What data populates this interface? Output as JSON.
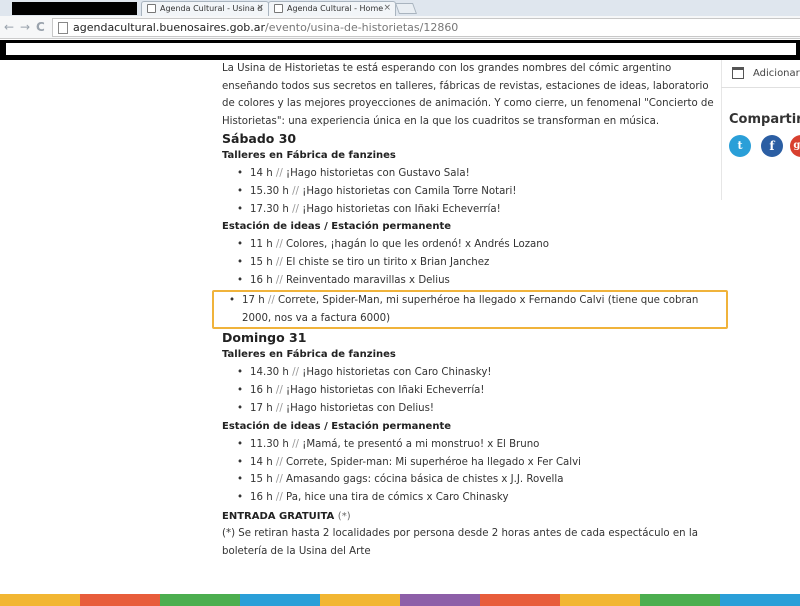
{
  "browser": {
    "tabs": [
      {
        "title": "Agenda Cultural - Usina d",
        "close": "×"
      },
      {
        "title": "Agenda Cultural - Home",
        "close": "×"
      }
    ],
    "nav": {
      "back": "←",
      "forward": "→",
      "reload": "C"
    },
    "url": {
      "domain": "agendacultural.buenosaires.gob.ar",
      "path": "/evento/usina-de-historietas/12860"
    }
  },
  "content": {
    "intro": "La Usina de Historietas te está esperando con los grandes nombres del cómic argentino enseñando todos sus secretos en talleres, fábricas de revistas, estaciones de ideas, laboratorio de colores y las mejores proyecciones de animación. Y como cierre, un fenomenal \"Concierto de Historietas\": una experiencia única en la que los cuadritos se transforman en música.",
    "separator": "//",
    "days": [
      {
        "title": "Sábado 30",
        "sections": [
          {
            "title": "Talleres en Fábrica de fanzines",
            "events": [
              {
                "time": "14 h",
                "text": "¡Hago historietas con Gustavo Sala!"
              },
              {
                "time": "15.30 h",
                "text": "¡Hago historietas con Camila Torre Notari!"
              },
              {
                "time": "17.30 h",
                "text": "¡Hago historietas con Iñaki Echeverría!"
              }
            ]
          },
          {
            "title": "Estación de ideas / Estación permanente",
            "events": [
              {
                "time": "11 h",
                "text": "Colores, ¡hagán lo que les ordenó! x Andrés Lozano"
              },
              {
                "time": "15 h",
                "text": "El chiste se tiro un tirito x Brian Janchez"
              },
              {
                "time": "16 h",
                "text": "Reinventado maravillas x Delius"
              },
              {
                "time": "17 h",
                "text": "Correte, Spider-Man, mi superhéroe ha llegado x Fernando Calvi (tiene que cobran 2000, nos va a factura 6000)"
              }
            ]
          }
        ]
      },
      {
        "title": "Domingo 31",
        "sections": [
          {
            "title": "Talleres en Fábrica de fanzines",
            "events": [
              {
                "time": "14.30 h",
                "text": "¡Hago historietas con Caro Chinasky!"
              },
              {
                "time": "16 h",
                "text": "¡Hago historietas con Iñaki Echeverría!"
              },
              {
                "time": "17 h",
                "text": "¡Hago historietas con Delius!"
              }
            ]
          },
          {
            "title": "Estación de ideas / Estación permanente",
            "events": [
              {
                "time": "11.30 h",
                "text": "¡Mamá, te presentó a mi monstruo! x El Bruno"
              },
              {
                "time": "14 h",
                "text": "Correte, Spider-man: Mi superhéroe ha llegado x Fer Calvi"
              },
              {
                "time": "15 h",
                "text": "Amasando gags: cócina básica de chistes x J.J. Rovella"
              },
              {
                "time": "16 h",
                "text": "Pa, hice una tira de cómics x Caro Chinasky"
              }
            ]
          }
        ]
      }
    ],
    "free_entry": "ENTRADA GRATUITA",
    "free_entry_mark": "(*)",
    "footnote": "(*) Se retiran hasta 2 localidades por persona desde 2 horas antes de cada espectáculo en la boletería de la Usina del Arte"
  },
  "sidebar": {
    "add_calendar": "Adicionar",
    "share_title": "Compartir",
    "social": {
      "twitter": "t",
      "facebook": "f",
      "google": "g+"
    }
  },
  "colors": {
    "highlight_border": "#f0b33b",
    "twitter": "#2a9fd8",
    "facebook": "#2b5ea3",
    "google": "#d8402f"
  },
  "footer_stripe": [
    "#f2b632",
    "#e85d3b",
    "#4cae4f",
    "#2a9fd8",
    "#f2b632",
    "#8d5fa8",
    "#e85d3b",
    "#f2b632",
    "#4cae4f",
    "#2a9fd8"
  ]
}
